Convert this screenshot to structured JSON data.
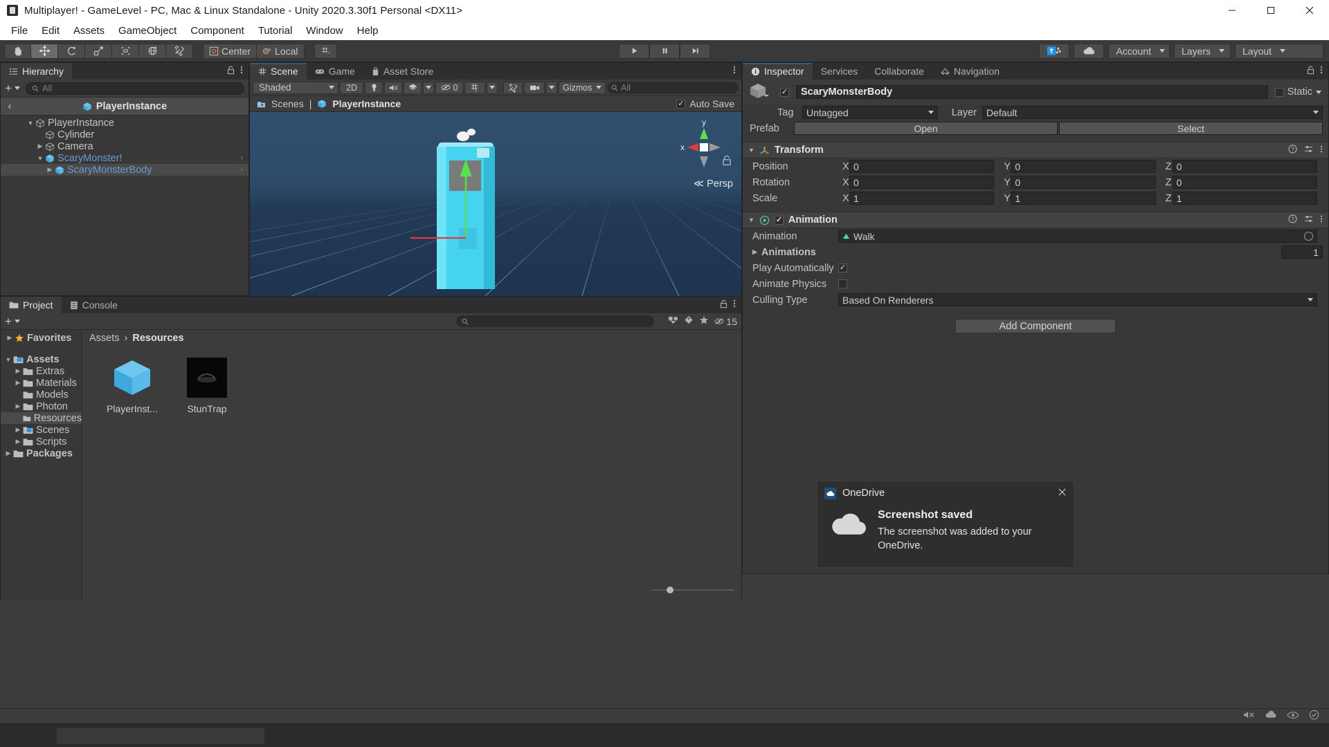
{
  "window": {
    "title": "Multiplayer! - GameLevel - PC, Mac & Linux Standalone - Unity 2020.3.30f1 Personal <DX11>",
    "app_icon": "unity-icon",
    "minimize": "minimize-icon",
    "maximize": "maximize-icon",
    "close": "close-icon"
  },
  "menubar": {
    "items": [
      {
        "label": "File"
      },
      {
        "label": "Edit"
      },
      {
        "label": "Assets"
      },
      {
        "label": "GameObject"
      },
      {
        "label": "Component"
      },
      {
        "label": "Tutorial"
      },
      {
        "label": "Window"
      },
      {
        "label": "Help"
      }
    ]
  },
  "toolbar": {
    "tools": [
      {
        "name": "hand-tool",
        "icon": "hand-icon",
        "active": false
      },
      {
        "name": "move-tool",
        "icon": "move-icon",
        "active": true
      },
      {
        "name": "rotate-tool",
        "icon": "rotate-icon",
        "active": false
      },
      {
        "name": "scale-tool",
        "icon": "scale-icon",
        "active": false
      },
      {
        "name": "rect-tool",
        "icon": "rect-icon",
        "active": false
      },
      {
        "name": "transform-tool",
        "icon": "transform-icon",
        "active": false
      },
      {
        "name": "custom-tool",
        "icon": "wrench-icon",
        "active": false
      }
    ],
    "pivot_mode": "Center",
    "pivot_rotation": "Local",
    "snap": "grid-snap-icon",
    "play": "play-icon",
    "pause": "pause-icon",
    "step": "step-icon",
    "collab": "collab-icon",
    "cloud": "cloud-icon",
    "account": "Account",
    "layers": "Layers",
    "layout": "Layout"
  },
  "hierarchy": {
    "tab": "Hierarchy",
    "search_placeholder": "All",
    "breadcrumb": "PlayerInstance",
    "tree": [
      {
        "label": "PlayerInstance",
        "depth": 1,
        "arrow": "down",
        "prefab": false,
        "selected": false,
        "chevron": false
      },
      {
        "label": "Cylinder",
        "depth": 2,
        "arrow": "none",
        "prefab": false,
        "selected": false,
        "chevron": false
      },
      {
        "label": "Camera",
        "depth": 2,
        "arrow": "right",
        "prefab": false,
        "selected": false,
        "chevron": false
      },
      {
        "label": "ScaryMonster!",
        "depth": 2,
        "arrow": "down",
        "prefab": true,
        "selected": false,
        "chevron": true
      },
      {
        "label": "ScaryMonsterBody",
        "depth": 3,
        "arrow": "right",
        "prefab": true,
        "selected": true,
        "chevron": true
      }
    ]
  },
  "scene": {
    "tabs": [
      {
        "label": "Scene",
        "icon": "scene-icon",
        "active": true
      },
      {
        "label": "Game",
        "icon": "game-icon",
        "active": false
      },
      {
        "label": "Asset Store",
        "icon": "store-icon",
        "active": false
      }
    ],
    "draw_mode": "Shaded",
    "mode_2d": "2D",
    "lighting": "lighting-icon",
    "audio": "audio-icon",
    "fx": "fx-icon",
    "hidden_count": "0",
    "grid": "grid-icon",
    "tool_settings": "wrench-icon",
    "camera": "camera-icon",
    "gizmos": "Gizmos",
    "search_placeholder": "All",
    "breadcrumb_scenes": "Scenes",
    "breadcrumb_prefab": "PlayerInstance",
    "auto_save": "Auto Save",
    "auto_save_checked": true,
    "axis_x": "x",
    "axis_y": "y",
    "perspective": "Persp"
  },
  "inspector": {
    "tabs": [
      {
        "label": "Inspector",
        "icon": "info-icon",
        "active": true
      },
      {
        "label": "Services",
        "icon": "",
        "active": false
      },
      {
        "label": "Collaborate",
        "icon": "",
        "active": false
      },
      {
        "label": "Navigation",
        "icon": "navigation-icon",
        "active": false
      }
    ],
    "object_name": "ScaryMonsterBody",
    "object_enabled": true,
    "static_label": "Static",
    "tag_label": "Tag",
    "tag_value": "Untagged",
    "layer_label": "Layer",
    "layer_value": "Default",
    "prefab_label": "Prefab",
    "prefab_open": "Open",
    "prefab_select": "Select",
    "components": [
      {
        "name": "Transform",
        "icon": "transform-icon",
        "rows": [
          {
            "label": "Position",
            "x": "0",
            "y": "0",
            "z": "0"
          },
          {
            "label": "Rotation",
            "x": "0",
            "y": "0",
            "z": "0"
          },
          {
            "label": "Scale",
            "x": "1",
            "y": "1",
            "z": "1"
          }
        ]
      }
    ],
    "animation": {
      "title": "Animation",
      "enabled": true,
      "animation_label": "Animation",
      "animation_value": "Walk",
      "animations_label": "Animations",
      "animations_size": "1",
      "play_automatically_label": "Play Automatically",
      "play_automatically": true,
      "animate_physics_label": "Animate Physics",
      "animate_physics": false,
      "culling_type_label": "Culling Type",
      "culling_type_value": "Based On Renderers"
    },
    "add_component": "Add Component"
  },
  "project": {
    "tabs": [
      {
        "label": "Project",
        "icon": "folder-icon",
        "active": true
      },
      {
        "label": "Console",
        "icon": "console-icon",
        "active": false
      }
    ],
    "search_placeholder": "",
    "visible_count": "15",
    "breadcrumb": [
      "Assets",
      "Resources"
    ],
    "tree": [
      {
        "label": "Favorites",
        "depth": 1,
        "arrow": "right",
        "icon": "star-icon",
        "selected": false
      },
      {
        "label": "Assets",
        "depth": 1,
        "arrow": "down",
        "icon": "unity-folder-icon",
        "selected": false
      },
      {
        "label": "Extras",
        "depth": 2,
        "arrow": "right",
        "icon": "folder-icon",
        "selected": false
      },
      {
        "label": "Materials",
        "depth": 2,
        "arrow": "right",
        "icon": "folder-icon",
        "selected": false
      },
      {
        "label": "Models",
        "depth": 2,
        "arrow": "none",
        "icon": "folder-icon",
        "selected": false
      },
      {
        "label": "Photon",
        "depth": 2,
        "arrow": "right",
        "icon": "folder-icon",
        "selected": false
      },
      {
        "label": "Resources",
        "depth": 2,
        "arrow": "none",
        "icon": "folder-icon",
        "selected": true
      },
      {
        "label": "Scenes",
        "depth": 2,
        "arrow": "right",
        "icon": "unity-folder-icon",
        "selected": false
      },
      {
        "label": "Scripts",
        "depth": 2,
        "arrow": "right",
        "icon": "folder-icon",
        "selected": false
      },
      {
        "label": "Packages",
        "depth": 1,
        "arrow": "right",
        "icon": "folder-icon",
        "selected": false
      }
    ],
    "assets": [
      {
        "label": "PlayerInst...",
        "type": "prefab"
      },
      {
        "label": "StunTrap",
        "type": "model"
      }
    ]
  },
  "toast": {
    "app": "OneDrive",
    "title": "Screenshot saved",
    "message": "The screenshot was added to your OneDrive.",
    "close": "close-icon"
  },
  "colors": {
    "accent_blue": "#2c5d87",
    "prefab_blue": "#6a9ad0",
    "panel_bg": "#383838",
    "toolbar_bg": "#393939",
    "cyan_model": "#45d3ef"
  }
}
